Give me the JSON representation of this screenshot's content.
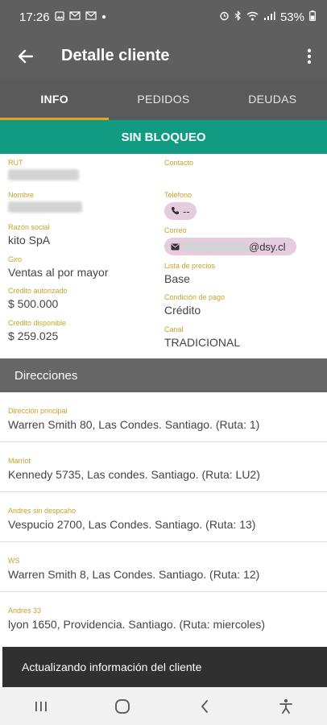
{
  "status_bar": {
    "time": "17:26",
    "battery": "53%"
  },
  "app_bar": {
    "title": "Detalle cliente"
  },
  "tabs": [
    {
      "label": "INFO",
      "active": true
    },
    {
      "label": "PEDIDOS",
      "active": false
    },
    {
      "label": "DEUDAS",
      "active": false
    }
  ],
  "banner": {
    "text": "SIN BLOQUEO",
    "color": "#119b82"
  },
  "info": {
    "rut": {
      "label": "RUT",
      "value": ""
    },
    "contacto": {
      "label": "Contacto",
      "value": ""
    },
    "nombre": {
      "label": "Nombre",
      "value": ""
    },
    "telefono": {
      "label": "Teléfono",
      "value": "--"
    },
    "razon_social": {
      "label": "Razón social",
      "value": "kito SpA"
    },
    "correo": {
      "label": "Correo",
      "value": "@dsy.cl"
    },
    "giro": {
      "label": "Giro",
      "value": "Ventas al por mayor"
    },
    "lista_precios": {
      "label": "Lista de precios",
      "value": "Base"
    },
    "credito_autorizado": {
      "label": "Crédito autorizado",
      "value": "$ 500.000"
    },
    "condicion_pago": {
      "label": "Condición de pago",
      "value": "Crédito"
    },
    "credito_disponible": {
      "label": "Crédito disponible",
      "value": "$ 259.025"
    },
    "canal": {
      "label": "Canal",
      "value": "TRADICIONAL"
    }
  },
  "direcciones": {
    "header": "Direcciones",
    "items": [
      {
        "label": "Dirección principal",
        "value": "Warren Smith 80, Las Condes. Santiago. (Ruta: 1)"
      },
      {
        "label": "Marriot",
        "value": "Kennedy 5735, Las condes. Santiago. (Ruta: LU2)"
      },
      {
        "label": "Andres sin despcaho",
        "value": "Vespucio 2700, Las Condes. Santiago. (Ruta: 13)"
      },
      {
        "label": "WS",
        "value": "Warren Smith 8, Las Condes. Santiago. (Ruta: 12)"
      },
      {
        "label": "Andres 33",
        "value": "lyon 1650, Providencia. Santiago. (Ruta: miercoles)"
      }
    ]
  },
  "snackbar": {
    "text": "Actualizando información del cliente"
  },
  "colors": {
    "app_bar": "#5f5f5f",
    "tab_indicator": "#f0a020",
    "label": "#c9a227",
    "chip": "#e5ccdf"
  }
}
